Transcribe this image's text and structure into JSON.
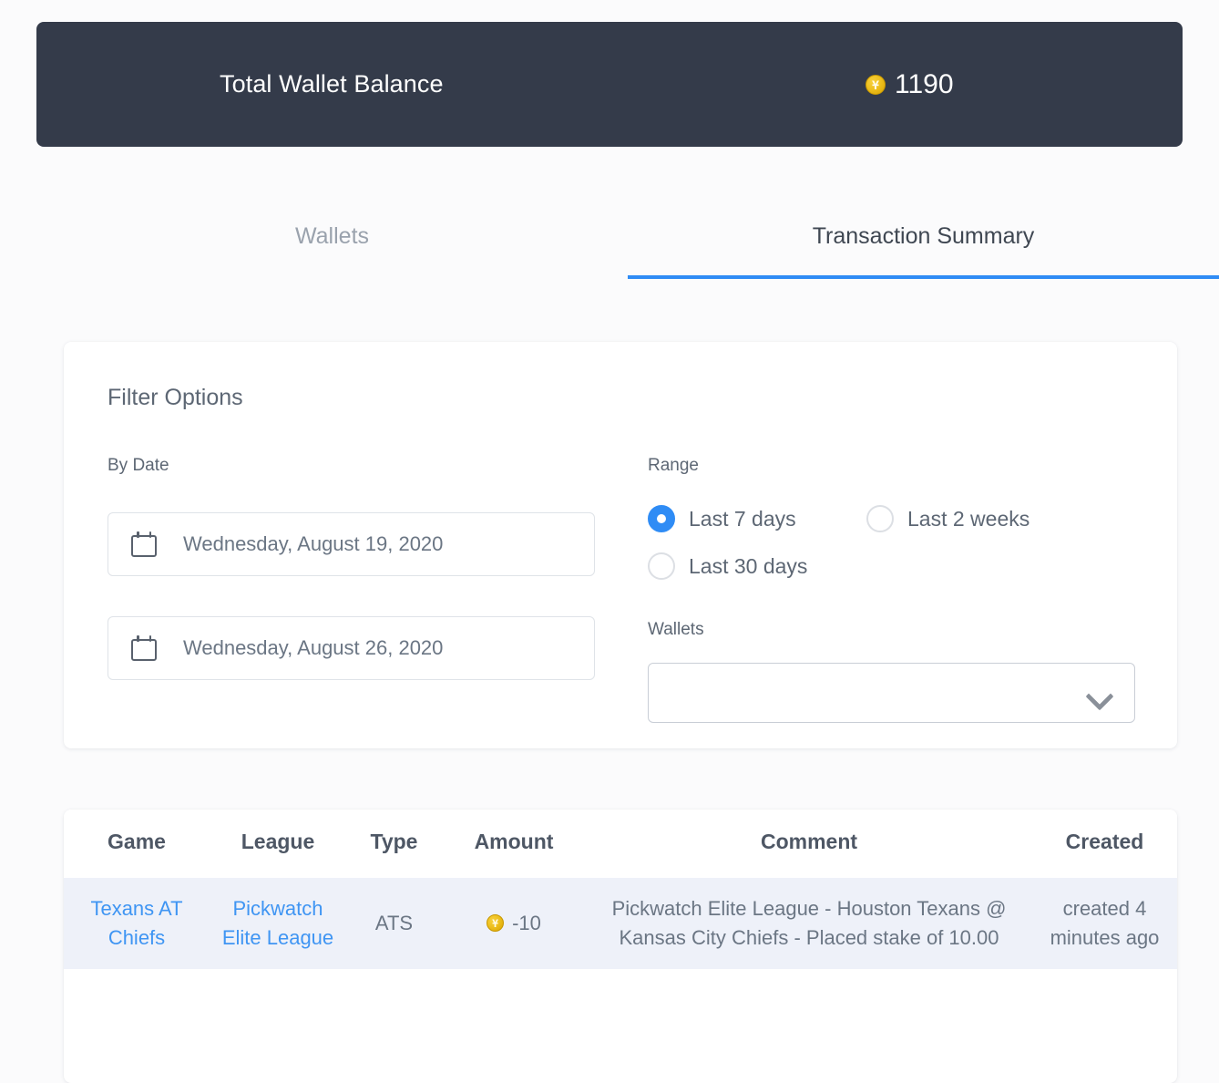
{
  "balance": {
    "label": "Total Wallet Balance",
    "coin_icon": "coin-icon",
    "coin_glyph": "Ұ",
    "amount": "1190"
  },
  "tabs": [
    {
      "label": "Wallets",
      "active": false
    },
    {
      "label": "Transaction Summary",
      "active": true
    }
  ],
  "filter": {
    "title": "Filter Options",
    "by_date_label": "By Date",
    "date_from": "Wednesday, August 19, 2020",
    "date_to": "Wednesday, August 26, 2020",
    "range_label": "Range",
    "range_options": [
      {
        "label": "Last 7 days",
        "selected": true
      },
      {
        "label": "Last 2 weeks",
        "selected": false
      },
      {
        "label": "Last 30 days",
        "selected": false
      }
    ],
    "wallets_label": "Wallets",
    "wallets_value": "",
    "wallets_chevron": "chevron-down-icon"
  },
  "table": {
    "headers": [
      "Game",
      "League",
      "Type",
      "Amount",
      "Comment",
      "Created"
    ],
    "rows": [
      {
        "game": "Texans AT Chiefs",
        "league": "Pickwatch Elite League",
        "type": "ATS",
        "amount": "-10",
        "amount_coin_glyph": "Ұ",
        "comment": "Pickwatch Elite League - Houston Texans @ Kansas City Chiefs - Placed stake of 10.00",
        "created": "created 4 minutes ago"
      }
    ]
  },
  "colors": {
    "header_bg": "#343b4a",
    "accent_blue": "#2f8cf5",
    "link_blue": "#3f95f3",
    "row_bg": "#eef1f9",
    "coin_gold": "#eec01f",
    "page_bg": "#fbfbfc"
  }
}
